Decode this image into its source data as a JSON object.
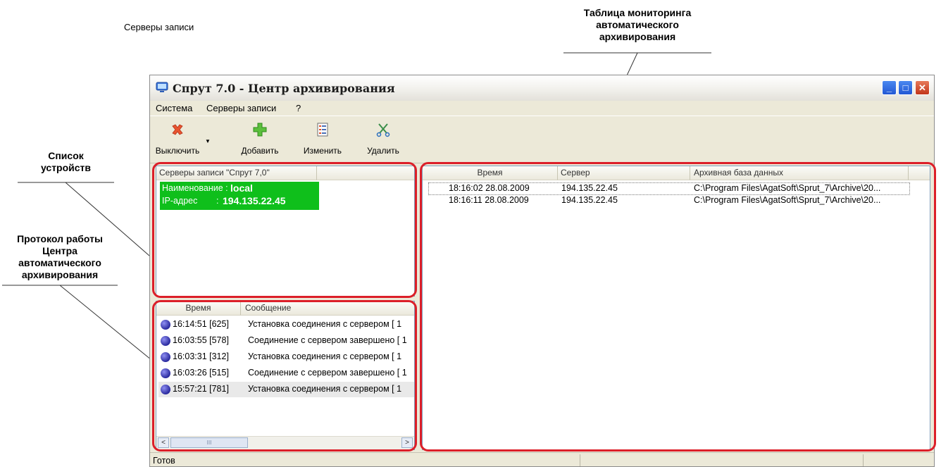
{
  "annotations": {
    "caption": "Серверы записи",
    "table_monitor": [
      "Таблица мониторинга",
      "автоматического",
      "архивирования"
    ],
    "device_list": [
      "Список",
      "устройств"
    ],
    "protocol": [
      "Протокол работы",
      "Центра",
      "автоматического",
      "архивирования"
    ]
  },
  "window": {
    "title": "Спрут 7.0 - Центр архивирования",
    "controls": {
      "minimize": "_",
      "maximize": "□",
      "close": "✕"
    }
  },
  "menu": [
    "Система",
    "Серверы записи",
    "?"
  ],
  "toolbar": {
    "off": "Выключить",
    "add": "Добавить",
    "edit": "Изменить",
    "delete": "Удалить"
  },
  "servers_panel": {
    "header": "Серверы записи \"Спрут 7,0\"",
    "name_label": "Наименование :",
    "name_value": "local",
    "ip_label": "IP-адрес",
    "ip_sep": ":",
    "ip_value": "194.135.22.45"
  },
  "log_panel": {
    "col_time": "Время",
    "col_message": "Сообщение",
    "rows": [
      {
        "time": "16:14:51 [625]",
        "message": "Установка соединения с сервером [ 1"
      },
      {
        "time": "16:03:55 [578]",
        "message": "Соединение с сервером завершено [ 1"
      },
      {
        "time": "16:03:31 [312]",
        "message": "Установка соединения с сервером [ 1"
      },
      {
        "time": "16:03:26 [515]",
        "message": "Соединение с сервером завершено [ 1"
      },
      {
        "time": "15:57:21 [781]",
        "message": "Установка соединения с сервером [ 1"
      }
    ],
    "scroll_left": "<",
    "scroll_right": ">",
    "scroll_thumb": "III"
  },
  "monitor_panel": {
    "col_time": "Время",
    "col_server": "Сервер",
    "col_db": "Архивная база данных",
    "rows": [
      {
        "time": "18:16:02 28.08.2009",
        "server": "194.135.22.45",
        "db": "C:\\Program Files\\AgatSoft\\Sprut_7\\Archive\\20..."
      },
      {
        "time": "18:16:11 28.08.2009",
        "server": "194.135.22.45",
        "db": "C:\\Program Files\\AgatSoft\\Sprut_7\\Archive\\20..."
      }
    ]
  },
  "status": {
    "text": "Готов"
  },
  "colors": {
    "highlight": "#dc1f29",
    "server_block": "#0fbf1b",
    "window_bg": "#ece9d8"
  }
}
